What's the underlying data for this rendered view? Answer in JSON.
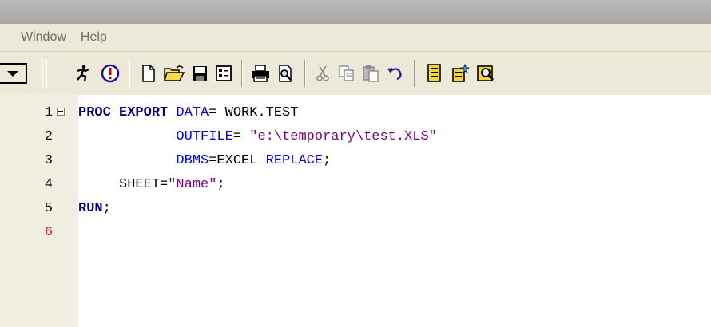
{
  "window": {
    "menu": [
      "Window",
      "Help"
    ]
  },
  "toolbar": {
    "buttons": [
      {
        "name": "submit-icon",
        "glyph": "🏃"
      },
      {
        "name": "break-icon",
        "glyph": "!"
      },
      {
        "name": "new-icon",
        "glyph": "new"
      },
      {
        "name": "open-icon",
        "glyph": "open"
      },
      {
        "name": "save-icon",
        "glyph": "save"
      },
      {
        "name": "properties-icon",
        "glyph": "props"
      },
      {
        "name": "print-icon",
        "glyph": "print"
      },
      {
        "name": "print-preview-icon",
        "glyph": "preview"
      },
      {
        "name": "cut-icon",
        "glyph": "✂"
      },
      {
        "name": "copy-icon",
        "glyph": "copy"
      },
      {
        "name": "paste-icon",
        "glyph": "paste"
      },
      {
        "name": "undo-icon",
        "glyph": "↶"
      },
      {
        "name": "library-icon",
        "glyph": "lib"
      },
      {
        "name": "explorer-icon",
        "glyph": "exp"
      },
      {
        "name": "find-icon",
        "glyph": "find"
      }
    ]
  },
  "editor": {
    "current_line": 6,
    "lines": [
      {
        "number": "1",
        "tokens": [
          {
            "t": "PROC EXPORT",
            "c": "kw"
          },
          {
            "t": " ",
            "c": "plain"
          },
          {
            "t": "DATA",
            "c": "opt"
          },
          {
            "t": "= WORK.TEST",
            "c": "plain"
          }
        ]
      },
      {
        "number": "2",
        "tokens": [
          {
            "t": "            ",
            "c": "plain"
          },
          {
            "t": "OUTFILE",
            "c": "opt"
          },
          {
            "t": "= ",
            "c": "plain"
          },
          {
            "t": "\"e:\\temporary\\test.XLS\"",
            "c": "str"
          }
        ]
      },
      {
        "number": "3",
        "tokens": [
          {
            "t": "            ",
            "c": "plain"
          },
          {
            "t": "DBMS",
            "c": "opt"
          },
          {
            "t": "=EXCEL ",
            "c": "plain"
          },
          {
            "t": "REPLACE",
            "c": "opt"
          },
          {
            "t": ";",
            "c": "plain"
          }
        ]
      },
      {
        "number": "4",
        "tokens": [
          {
            "t": "     SHEET=",
            "c": "plain"
          },
          {
            "t": "\"Name\"",
            "c": "str"
          },
          {
            "t": ";",
            "c": "plain"
          }
        ]
      },
      {
        "number": "5",
        "tokens": [
          {
            "t": "RUN",
            "c": "kw"
          },
          {
            "t": ";",
            "c": "plain"
          }
        ]
      },
      {
        "number": "6",
        "tokens": []
      }
    ]
  },
  "colors": {
    "keyword": "#000080",
    "option": "#0000ff",
    "string": "#800080",
    "current_line_number": "#ff0000"
  }
}
